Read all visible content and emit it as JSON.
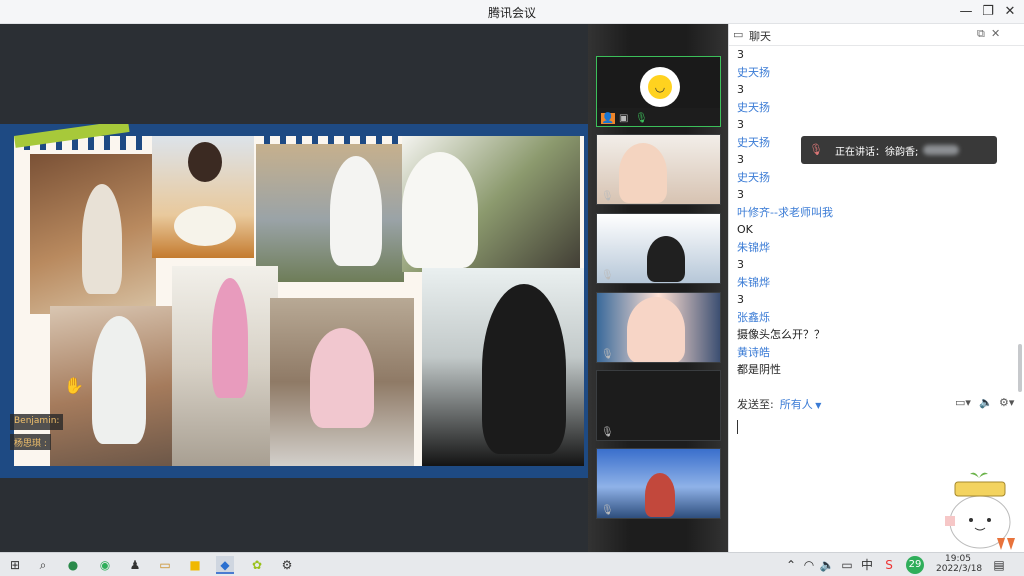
{
  "window": {
    "title": "腾讯会议"
  },
  "share": {
    "labels": [
      {
        "name": "Benjamin:",
        "suffix": "✋"
      },
      {
        "name": "杨思琪 :",
        "suffix": ""
      }
    ]
  },
  "chat": {
    "title": "聊天",
    "messages": [
      {
        "kind": "body",
        "text": "3"
      },
      {
        "kind": "sender",
        "text": "史天扬"
      },
      {
        "kind": "body",
        "text": "3"
      },
      {
        "kind": "sender",
        "text": "史天扬"
      },
      {
        "kind": "body",
        "text": "3"
      },
      {
        "kind": "sender",
        "text": "史天扬"
      },
      {
        "kind": "body",
        "text": "3"
      },
      {
        "kind": "sender",
        "text": "史天扬"
      },
      {
        "kind": "body",
        "text": "3"
      },
      {
        "kind": "sender",
        "text": "叶修齐--求老师叫我"
      },
      {
        "kind": "body",
        "text": "OK"
      },
      {
        "kind": "sender",
        "text": "朱锦烨"
      },
      {
        "kind": "body",
        "text": "3"
      },
      {
        "kind": "sender",
        "text": "朱锦烨"
      },
      {
        "kind": "body",
        "text": "3"
      },
      {
        "kind": "sender",
        "text": "张鑫烁"
      },
      {
        "kind": "body",
        "text": "摄像头怎么开？？"
      },
      {
        "kind": "sender",
        "text": "黄诗皓"
      },
      {
        "kind": "body",
        "text": "都是阴性"
      }
    ],
    "speaking_label": "正在讲话：徐韵香;",
    "send_to_label": "发送至:",
    "send_to_target": "所有人",
    "input_placeholder": ""
  },
  "taskbar": {
    "time": "19:05",
    "date": "2022/3/18",
    "ime": "中",
    "badge": "29"
  },
  "colors": {
    "accent": "#3a7bd5",
    "active_tile": "#3cbf5a"
  },
  "icons": [
    "search-icon",
    "close-icon",
    "minimize-icon",
    "maximize-icon",
    "mic-icon",
    "camera-icon",
    "folder-icon",
    "volume-icon"
  ]
}
